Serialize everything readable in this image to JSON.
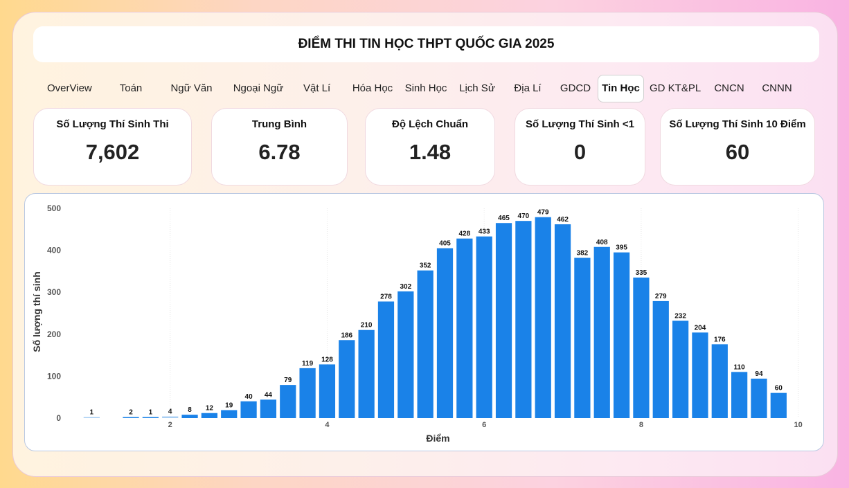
{
  "title": "ĐIỂM THI TIN HỌC THPT QUỐC GIA 2025",
  "tabs": [
    {
      "label": "OverView",
      "active": false
    },
    {
      "label": "Toán",
      "active": false
    },
    {
      "label": "Ngữ Văn",
      "active": false
    },
    {
      "label": "Ngoại Ngữ",
      "active": false
    },
    {
      "label": "Vật Lí",
      "active": false
    },
    {
      "label": "Hóa Học",
      "active": false
    },
    {
      "label": "Sinh Học",
      "active": false
    },
    {
      "label": "Lịch Sử",
      "active": false
    },
    {
      "label": "Địa Lí",
      "active": false
    },
    {
      "label": "GDCD",
      "active": false
    },
    {
      "label": "Tin Học",
      "active": true
    },
    {
      "label": "GD KT&PL",
      "active": false
    },
    {
      "label": "CNCN",
      "active": false
    },
    {
      "label": "CNNN",
      "active": false
    }
  ],
  "cards": [
    {
      "label": "Số Lượng Thí Sinh Thi",
      "value": "7,602"
    },
    {
      "label": "Trung Bình",
      "value": "6.78"
    },
    {
      "label": "Độ Lệch Chuẩn",
      "value": "1.48"
    },
    {
      "label": "Số Lượng Thí Sinh <1",
      "value": "0"
    },
    {
      "label": "Số Lượng Thí Sinh 10 Điểm",
      "value": "60"
    }
  ],
  "colors": {
    "bar": "#1a82e8",
    "bar_light": "#a9cff3"
  },
  "chart_data": {
    "type": "bar",
    "xlabel": "Điểm",
    "ylabel": "Số lượng thí sinh",
    "ylim": [
      0,
      500
    ],
    "yticks": [
      0,
      100,
      200,
      300,
      400,
      500
    ],
    "xticks": [
      2,
      4,
      6,
      8,
      10
    ],
    "xlim": [
      0.75,
      10.25
    ],
    "grid": "vertical",
    "x": [
      1,
      1.5,
      1.75,
      2,
      2.25,
      2.5,
      2.75,
      3,
      3.25,
      3.5,
      3.75,
      4,
      4.25,
      4.5,
      4.75,
      5,
      5.25,
      5.5,
      5.75,
      6,
      6.25,
      6.5,
      6.75,
      7,
      7.25,
      7.5,
      7.75,
      8,
      8.25,
      8.5,
      8.75,
      9,
      9.25,
      9.5,
      9.75,
      10
    ],
    "values": [
      1,
      2,
      1,
      4,
      8,
      12,
      19,
      40,
      44,
      79,
      119,
      128,
      186,
      210,
      278,
      302,
      352,
      405,
      428,
      433,
      465,
      470,
      479,
      462,
      382,
      408,
      395,
      335,
      279,
      232,
      204,
      176,
      110,
      94,
      60
    ],
    "light_x": [
      1,
      2
    ]
  }
}
